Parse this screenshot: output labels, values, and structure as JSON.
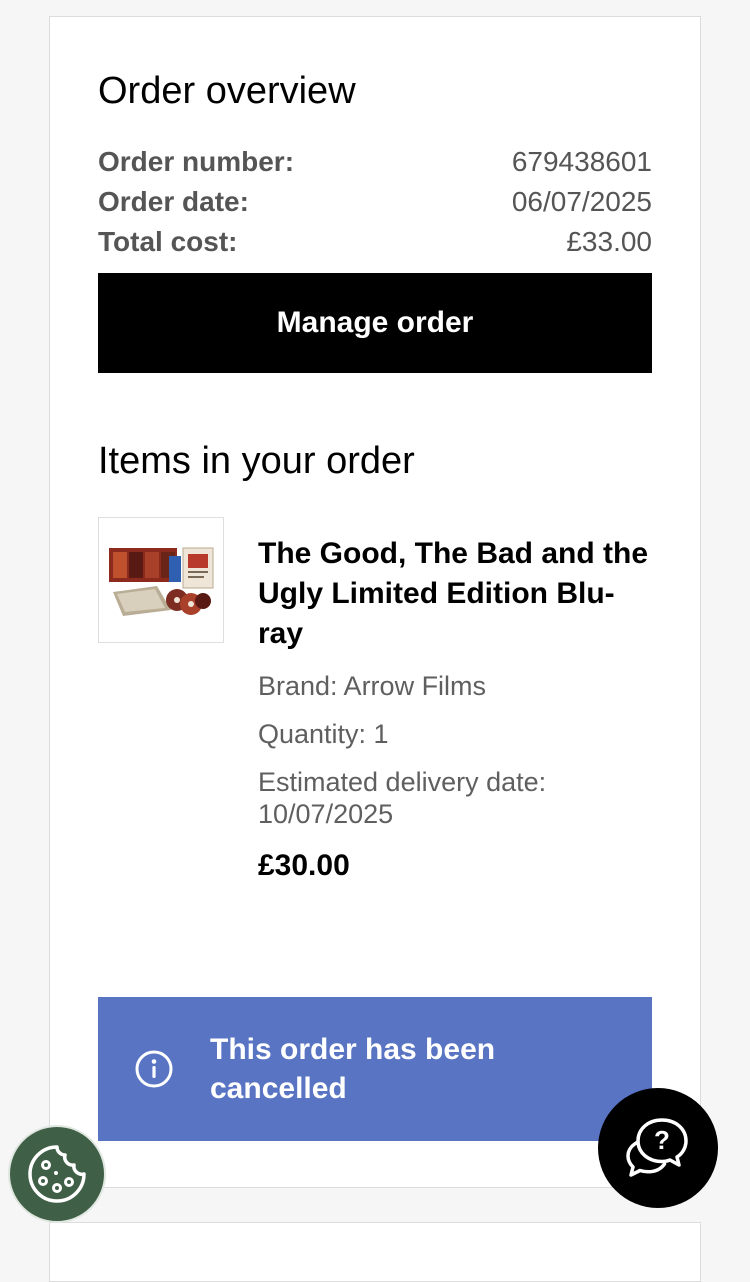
{
  "overview": {
    "title": "Order overview",
    "rows": [
      {
        "label": "Order number:",
        "value": "679438601"
      },
      {
        "label": "Order date:",
        "value": "06/07/2025"
      },
      {
        "label": "Total cost:",
        "value": "£33.00"
      }
    ],
    "manage_label": "Manage order"
  },
  "items": {
    "title": "Items in your order",
    "list": [
      {
        "name": "The Good, The Bad and the Ugly Limited Edition Blu-ray",
        "brand": "Brand: Arrow Films",
        "quantity": "Quantity: 1",
        "delivery_label": "Estimated delivery date:",
        "delivery_date": "10/07/2025",
        "price": "£30.00",
        "thumbnail_icon": "product-image"
      }
    ]
  },
  "status_banner": {
    "text": "This order has been cancelled",
    "icon": "info-icon",
    "color": "#5874c3"
  },
  "floating": {
    "cookie_icon": "cookie-icon",
    "cookie_color": "#3f5f46",
    "help_icon": "help-chat-icon"
  }
}
